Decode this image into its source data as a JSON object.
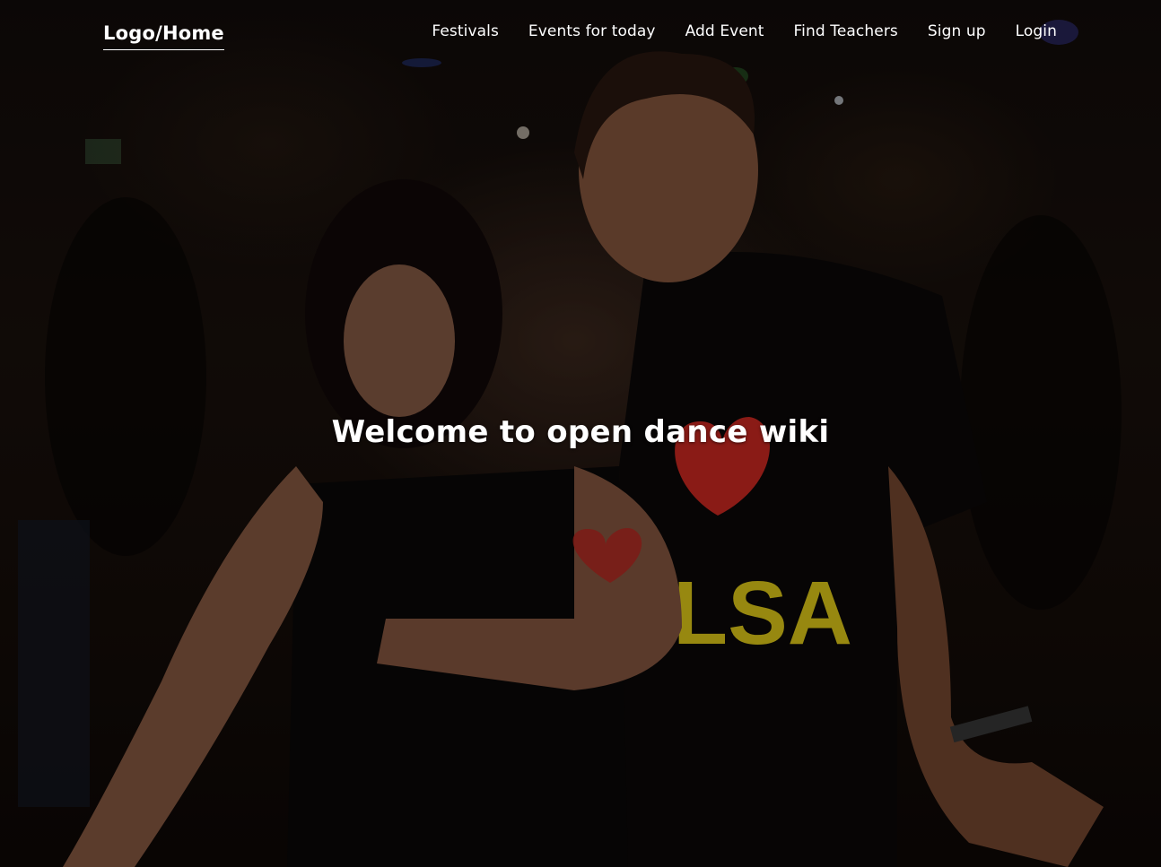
{
  "nav": {
    "logo": "Logo/Home",
    "items": [
      {
        "label": "Festivals"
      },
      {
        "label": "Events for today"
      },
      {
        "label": "Add Event"
      },
      {
        "label": "Find Teachers"
      },
      {
        "label": "Sign up"
      },
      {
        "label": "Login"
      }
    ]
  },
  "hero": {
    "title": "Welcome to open dance wiki",
    "background_image": "couple-dancing-salsa-photo",
    "shirt_text": "LSA"
  },
  "colors": {
    "text": "#ffffff",
    "background": "#120c0a",
    "heart": "#d42a22",
    "shirt_text": "#e8d21a"
  }
}
